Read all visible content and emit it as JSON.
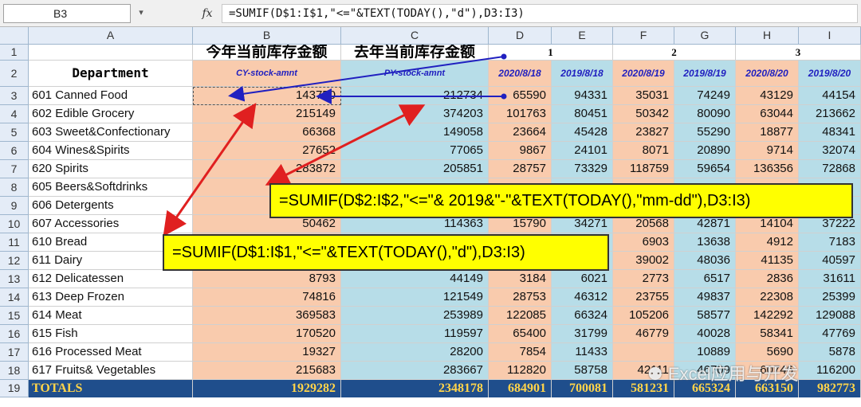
{
  "formula_bar": {
    "name_box": "B3",
    "fx_label": "fx",
    "formula": "=SUMIF(D$1:I$1,\"<=\"&TEXT(TODAY(),\"d\"),D3:I3)"
  },
  "column_headers": [
    "A",
    "B",
    "C",
    "D",
    "E",
    "F",
    "G",
    "H",
    "I"
  ],
  "row_numbers": [
    "1",
    "2",
    "3",
    "4",
    "5",
    "6",
    "7",
    "8",
    "9",
    "10",
    "11",
    "12",
    "13",
    "14",
    "15",
    "16",
    "17",
    "18",
    "19"
  ],
  "header_row1": {
    "cy_title": "今年当前库存金额",
    "py_title": "去年当前库存金额",
    "group1": "1",
    "group2": "2",
    "group3": "3"
  },
  "header_row2": {
    "department": "Department",
    "cy_code": "CY-stock-amnt",
    "py_code": "PY-stock-amnt",
    "dates": [
      "2020/8/18",
      "2019/8/18",
      "2020/8/19",
      "2019/8/19",
      "2020/8/20",
      "2019/8/20"
    ]
  },
  "rows": [
    {
      "dept": "601 Canned Food",
      "b": "143750",
      "c": "212734",
      "d": "65590",
      "e": "94331",
      "f": "35031",
      "g": "74249",
      "h": "43129",
      "i": "44154"
    },
    {
      "dept": "602 Edible Grocery",
      "b": "215149",
      "c": "374203",
      "d": "101763",
      "e": "80451",
      "f": "50342",
      "g": "80090",
      "h": "63044",
      "i": "213662"
    },
    {
      "dept": "603 Sweet&Confectionary",
      "b": "66368",
      "c": "149058",
      "d": "23664",
      "e": "45428",
      "f": "23827",
      "g": "55290",
      "h": "18877",
      "i": "48341"
    },
    {
      "dept": "604 Wines&Spirits",
      "b": "27652",
      "c": "77065",
      "d": "9867",
      "e": "24101",
      "f": "8071",
      "g": "20890",
      "h": "9714",
      "i": "32074"
    },
    {
      "dept": "620 Spirits",
      "b": "283872",
      "c": "205851",
      "d": "28757",
      "e": "73329",
      "f": "118759",
      "g": "59654",
      "h": "136356",
      "i": "72868"
    },
    {
      "dept": "605 Beers&Softdrinks",
      "b": "",
      "c": "",
      "d": "",
      "e": "",
      "f": "",
      "g": "",
      "h": "",
      "i": ""
    },
    {
      "dept": "606 Detergents",
      "b": "",
      "c": "",
      "d": "",
      "e": "",
      "f": "",
      "g": "",
      "h": "",
      "i": ""
    },
    {
      "dept": "607 Accessories",
      "b": "50462",
      "c": "114363",
      "d": "15790",
      "e": "34271",
      "f": "20568",
      "g": "42871",
      "h": "14104",
      "i": "37222"
    },
    {
      "dept": "610 Bread",
      "b": "",
      "c": "",
      "d": "",
      "e": "",
      "f": "6903",
      "g": "13638",
      "h": "4912",
      "i": "7183"
    },
    {
      "dept": "611 Dairy",
      "b": "",
      "c": "",
      "d": "",
      "e": "",
      "f": "39002",
      "g": "48036",
      "h": "41135",
      "i": "40597"
    },
    {
      "dept": "612 Delicatessen",
      "b": "8793",
      "c": "44149",
      "d": "3184",
      "e": "6021",
      "f": "2773",
      "g": "6517",
      "h": "2836",
      "i": "31611"
    },
    {
      "dept": "613 Deep Frozen",
      "b": "74816",
      "c": "121549",
      "d": "28753",
      "e": "46312",
      "f": "23755",
      "g": "49837",
      "h": "22308",
      "i": "25399"
    },
    {
      "dept": "614 Meat",
      "b": "369583",
      "c": "253989",
      "d": "122085",
      "e": "66324",
      "f": "105206",
      "g": "58577",
      "h": "142292",
      "i": "129088"
    },
    {
      "dept": "615 Fish",
      "b": "170520",
      "c": "119597",
      "d": "65400",
      "e": "31799",
      "f": "46779",
      "g": "40028",
      "h": "58341",
      "i": "47769"
    },
    {
      "dept": "616 Processed Meat",
      "b": "19327",
      "c": "28200",
      "d": "7854",
      "e": "11433",
      "f": "",
      "g": "10889",
      "h": "5690",
      "i": "5878"
    },
    {
      "dept": "617 Fruits& Vegetables",
      "b": "215683",
      "c": "283667",
      "d": "112820",
      "e": "58758",
      "f": "42111",
      "g": "46709",
      "h": "60746",
      "i": "116200"
    }
  ],
  "totals": {
    "label": "TOTALS",
    "b": "1929282",
    "c": "2348178",
    "d": "684901",
    "e": "700081",
    "f": "581231",
    "g": "665324",
    "h": "663150",
    "i": "982773"
  },
  "callouts": {
    "py_formula": "=SUMIF(D$2:I$2,\"<=\"& 2019&\"-\"&TEXT(TODAY(),\"mm-dd\"),D3:I3)",
    "cy_formula": "=SUMIF(D$1:I$1,\"<=\"&TEXT(TODAY(),\"d\"),D3:I3)"
  },
  "watermark": "Excel应用与开发",
  "colors": {
    "orange": "#f9cbad",
    "blue": "#b7dde8",
    "totals_bg": "#1f4e8c",
    "totals_text": "#ffd44a",
    "callout": "#ffff00",
    "arrow_red": "#e02020",
    "arrow_blue": "#2020c0"
  }
}
